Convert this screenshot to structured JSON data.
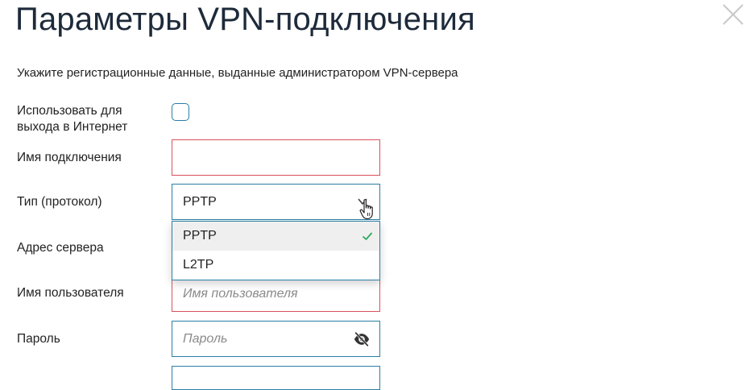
{
  "dialog": {
    "title": "Параметры VPN-подключения",
    "subtitle": "Укажите регистрационные данные, выданные администратором VPN-сервера"
  },
  "form": {
    "use_internet_label": "Использовать для выхода в Интернет",
    "use_internet_checked": false,
    "connection_name_label": "Имя подключения",
    "connection_name_value": "",
    "protocol_label": "Тип (протокол)",
    "protocol_value": "PPTP",
    "protocol_options": [
      {
        "label": "PPTP",
        "selected": true
      },
      {
        "label": "L2TP",
        "selected": false
      }
    ],
    "server_address_label": "Адрес сервера",
    "username_label": "Имя пользователя",
    "username_placeholder": "Имя пользователя",
    "password_label": "Пароль",
    "password_placeholder": "Пароль"
  },
  "colors": {
    "accent": "#2a7fa5",
    "error": "#d9505d",
    "check": "#2eaa5c",
    "title": "#1d2a3a"
  },
  "icons": {
    "close": "close-icon",
    "chevron": "chevron-down-icon",
    "visibility": "eye-slash-icon",
    "selected": "checkmark-icon",
    "pointer": "hand-cursor-icon"
  }
}
